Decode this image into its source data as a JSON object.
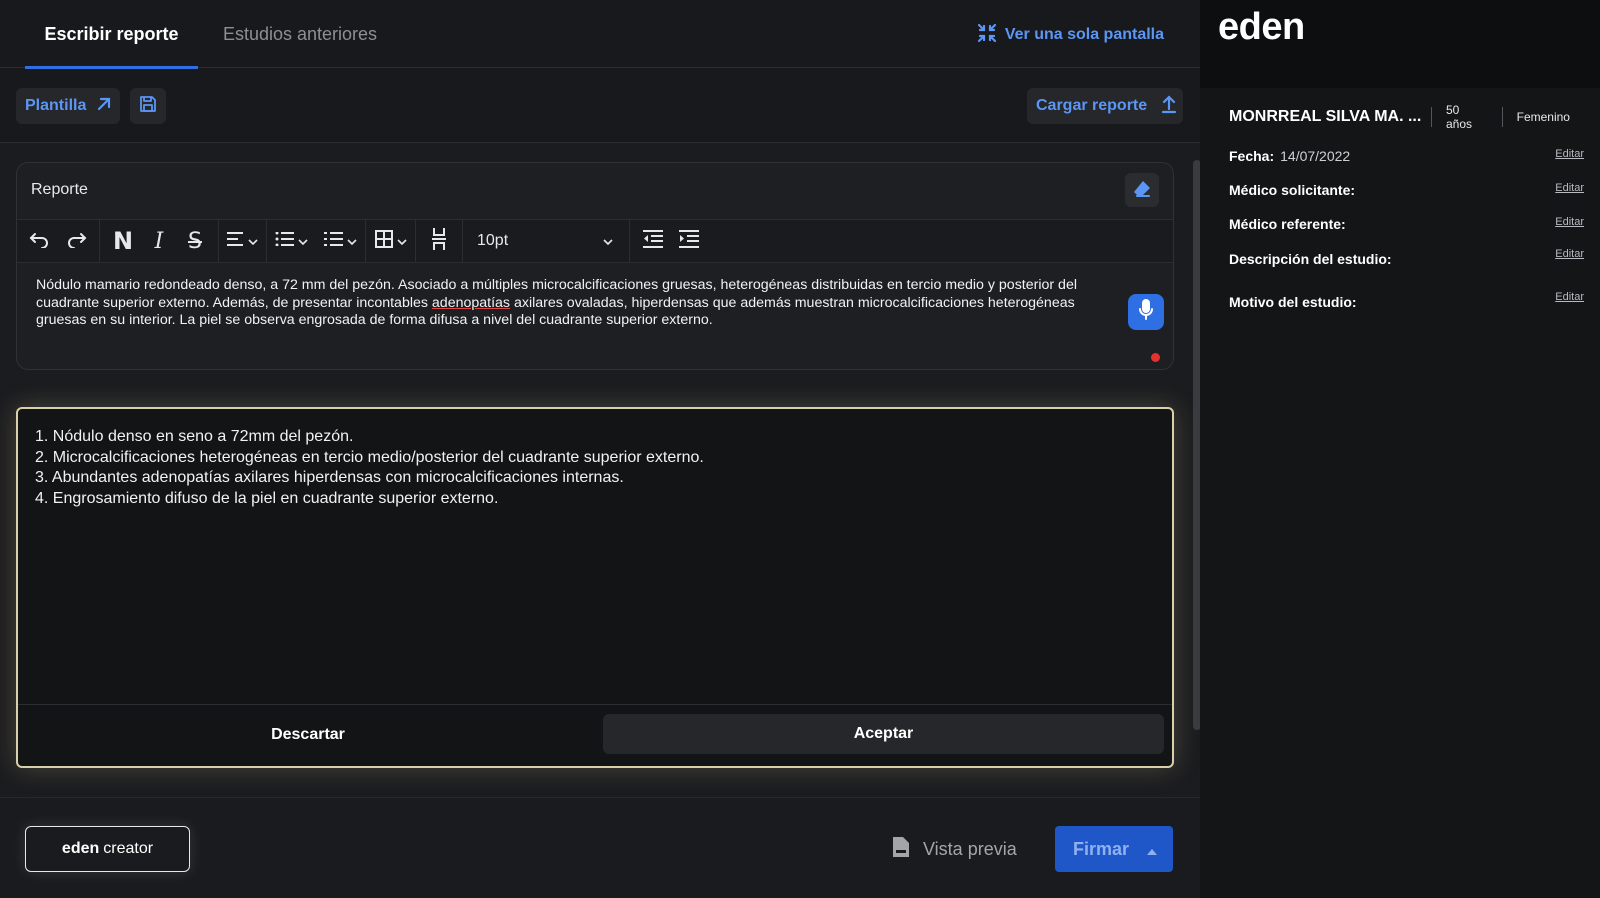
{
  "tabs": [
    {
      "label": "Escribir reporte",
      "active": true
    },
    {
      "label": "Estudios anteriores",
      "active": false
    }
  ],
  "header": {
    "single_screen_label": "Ver una sola pantalla"
  },
  "actions": {
    "plantilla_label": "Plantilla",
    "cargar_label": "Cargar reporte"
  },
  "editor": {
    "title": "Reporte",
    "font_size": "10pt",
    "text_line1": "Nódulo mamario redondeado denso, a 72 mm del pezón. Asociado a múltiples microcalcificaciones gruesas, heterogéneas distribuidas en tercio medio y posterior del",
    "text_line2_a": "cuadrante superior externo. Además, de presentar incontables ",
    "text_line2_err": "adenopatías",
    "text_line2_b": " axilares ovaladas, hiperdensas que además muestran microcalcificaciones heterogéneas",
    "text_line3": "gruesas en su interior. La piel se observa engrosada de forma difusa a nivel del cuadrante superior externo."
  },
  "ai_summary": {
    "items": [
      "1. Nódulo denso en seno a 72mm del pezón.",
      "2. Microcalcificaciones heterogéneas en tercio medio/posterior del cuadrante superior externo.",
      "3. Abundantes adenopatías axilares hiperdensas con microcalcificaciones internas.",
      "4. Engrosamiento difuso de la piel en cuadrante superior externo."
    ],
    "discard_label": "Descartar",
    "accept_label": "Aceptar"
  },
  "bottom": {
    "creator_brand": "eden",
    "creator_word": "creator",
    "preview_label": "Vista previa",
    "sign_label": "Firmar"
  },
  "sidebar": {
    "logo": "eden",
    "patient_name": "MONRREAL SILVA MA. ...",
    "age": "50 años",
    "sex": "Femenino",
    "fecha_label": "Fecha:",
    "fecha_value": "14/07/2022",
    "solicitante_label": "Médico solicitante:",
    "referente_label": "Médico referente:",
    "descripcion_label": "Descripción del estudio:",
    "motivo_label": "Motivo del estudio:",
    "edit_label": "Editar"
  },
  "colors": {
    "accent": "#5b96f5",
    "primary": "#2f6fe4",
    "highlight_border": "#d9cfa8",
    "record_dot": "#e5322e"
  }
}
